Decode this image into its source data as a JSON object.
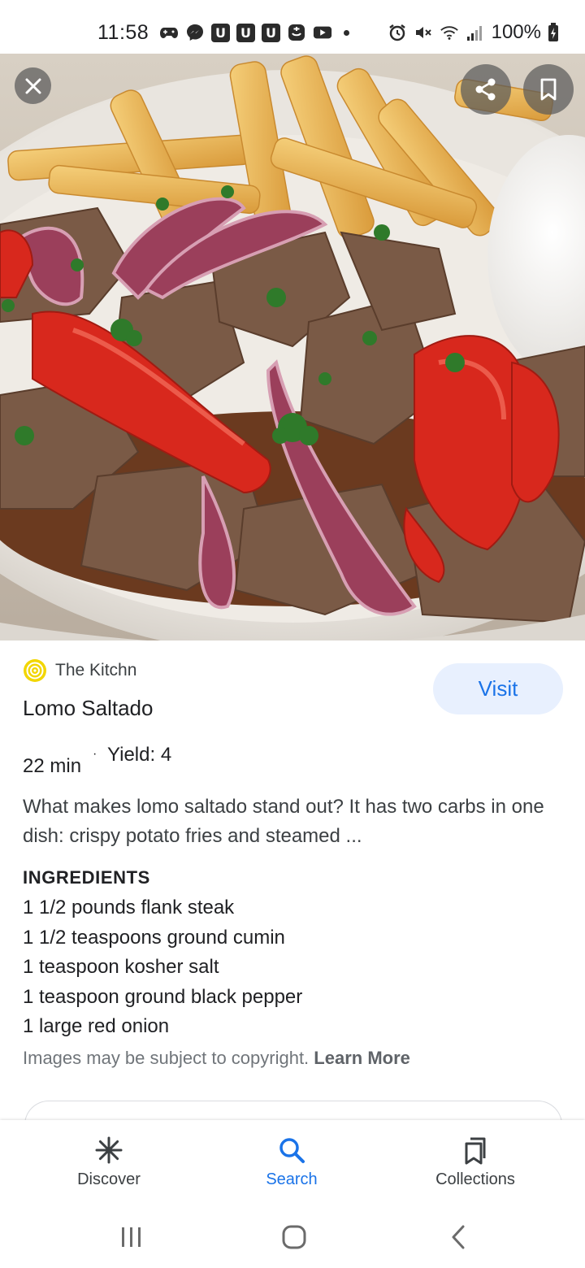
{
  "status_bar": {
    "time": "11:58",
    "battery": "100%",
    "left_icons": [
      "game-controller-icon",
      "messenger-icon",
      "u-app-icon",
      "u-app-icon",
      "u-app-icon",
      "app-icon",
      "youtube-icon",
      "dot-icon"
    ],
    "right_icons": [
      "alarm-icon",
      "mute-icon",
      "wifi-icon",
      "signal-icon",
      "battery-charging-icon"
    ]
  },
  "hero": {
    "close_icon": "close-icon",
    "share_icon": "share-icon",
    "save_icon": "bookmark-icon"
  },
  "result": {
    "source_name": "The Kitchn",
    "visit_label": "Visit",
    "title": "Lomo Saltado",
    "time": "22 min",
    "separator": "·",
    "yield": "Yield: 4",
    "description": "What makes lomo saltado stand out? It has two carbs in one dish: crispy potato fries and steamed ...",
    "ingredients_heading": "INGREDIENTS",
    "ingredients": [
      "1 1/2 pounds flank steak",
      "1 1/2 teaspoons ground cumin",
      "1 teaspoon kosher salt",
      "1 teaspoon ground black pepper",
      "1 large red onion"
    ],
    "copyright_text": "Images may be subject to copyright.",
    "learn_more_label": "Learn More"
  },
  "bottom_nav": {
    "items": [
      {
        "label": "Discover",
        "icon": "asterisk-icon",
        "active": false
      },
      {
        "label": "Search",
        "icon": "search-icon",
        "active": true
      },
      {
        "label": "Collections",
        "icon": "collections-icon",
        "active": false
      }
    ]
  },
  "system_nav": {
    "buttons": [
      "recents-icon",
      "home-icon",
      "back-icon"
    ]
  },
  "colors": {
    "accent": "#1a73e8",
    "visit_bg": "#e8f0fe",
    "text_primary": "#202124",
    "text_secondary": "#3c4043",
    "muted": "#70757a"
  }
}
